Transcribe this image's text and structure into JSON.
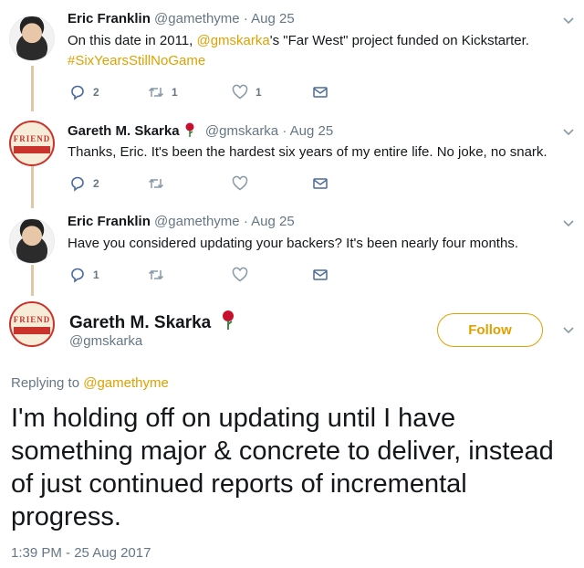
{
  "tweets": [
    {
      "name": "Eric Franklin",
      "handle": "@gamethyme",
      "date": "Aug 25",
      "text_before": "On this date in 2011, ",
      "mention": "@gmskarka",
      "text_after": "'s \"Far West\" project funded on Kickstarter.",
      "hashtag": "#SixYearsStillNoGame",
      "replies": "2",
      "retweets": "1",
      "likes": "1"
    },
    {
      "name": "Gareth M. Skarka",
      "handle": "@gmskarka",
      "date": "Aug 25",
      "text": "Thanks, Eric.  It's been the hardest six years of my entire life. No joke, no snark.",
      "replies": "2",
      "retweets": "",
      "likes": ""
    },
    {
      "name": "Eric Franklin",
      "handle": "@gamethyme",
      "date": "Aug 25",
      "text": "Have you considered updating your backers? It's been nearly four months.",
      "replies": "1",
      "retweets": "",
      "likes": ""
    }
  ],
  "main": {
    "name": "Gareth M. Skarka",
    "handle": "@gmskarka",
    "follow_label": "Follow",
    "replying_prefix": "Replying to ",
    "replying_to": "@gamethyme",
    "text": "I'm holding off on updating until I have something major & concrete to deliver, instead of just continued reports of incremental progress.",
    "timestamp": "1:39 PM - 25 Aug 2017"
  },
  "avatar_badge_text": "FRIEND",
  "separator": "·",
  "colors": {
    "accent": "#e0a100",
    "muted": "#657786",
    "thread_line": "#e1c7a4",
    "rose": "#c8102e"
  }
}
